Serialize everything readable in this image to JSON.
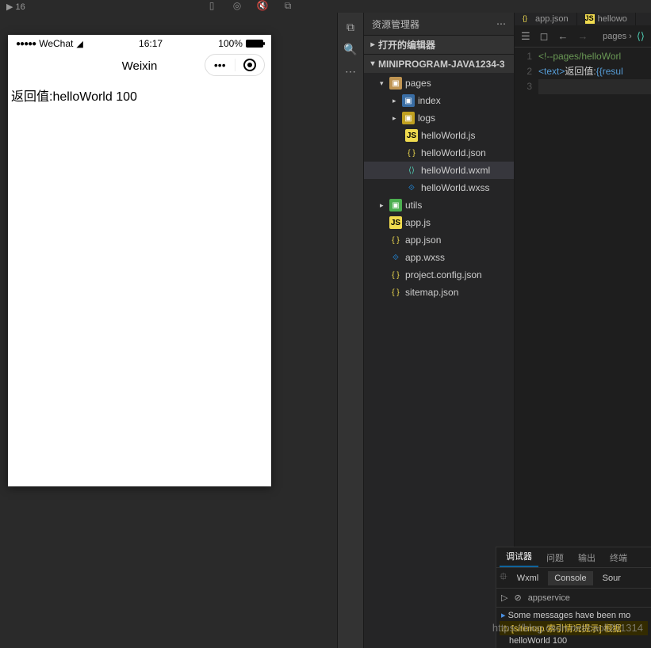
{
  "topStrip": "▶ 16",
  "simulator": {
    "statusbar": {
      "carrier": "WeChat",
      "time": "16:17",
      "battery": "100%"
    },
    "title": "Weixin",
    "content": "返回值:helloWorld 100"
  },
  "explorer": {
    "title": "资源管理器",
    "sections": {
      "openEditors": "打开的编辑器",
      "project": "MINIPROGRAM-JAVA1234-3"
    },
    "tree": {
      "pages": "pages",
      "index": "index",
      "logs": "logs",
      "hwjs": "helloWorld.js",
      "hwjson": "helloWorld.json",
      "hwwxml": "helloWorld.wxml",
      "hwwxss": "helloWorld.wxss",
      "utils": "utils",
      "appjs": "app.js",
      "appjson": "app.json",
      "appwxss": "app.wxss",
      "projectconfig": "project.config.json",
      "sitemap": "sitemap.json"
    }
  },
  "editor": {
    "tabs": {
      "appjson": "app.json",
      "hellowo": "hellowo"
    },
    "breadcrumb": "pages ›",
    "line1_comment": "<!--pages/helloWorl",
    "line2_prefix": "<text>",
    "line2_text": "返回值:",
    "line2_expr": "{{resul"
  },
  "debug": {
    "tabs": {
      "debugger": "调试器",
      "issues": "问题",
      "output": "输出",
      "terminal": "终端"
    },
    "subtabs": {
      "wxml": "Wxml",
      "console": "Console",
      "sour": "Sour"
    },
    "context": "appservice",
    "lines": {
      "l1": "Some messages have been mo",
      "l2": "[sitemap 索引情况提示] 根据",
      "l3": "helloWorld 100"
    }
  },
  "watermark": "https://blog.csdn.net/caoli201314"
}
